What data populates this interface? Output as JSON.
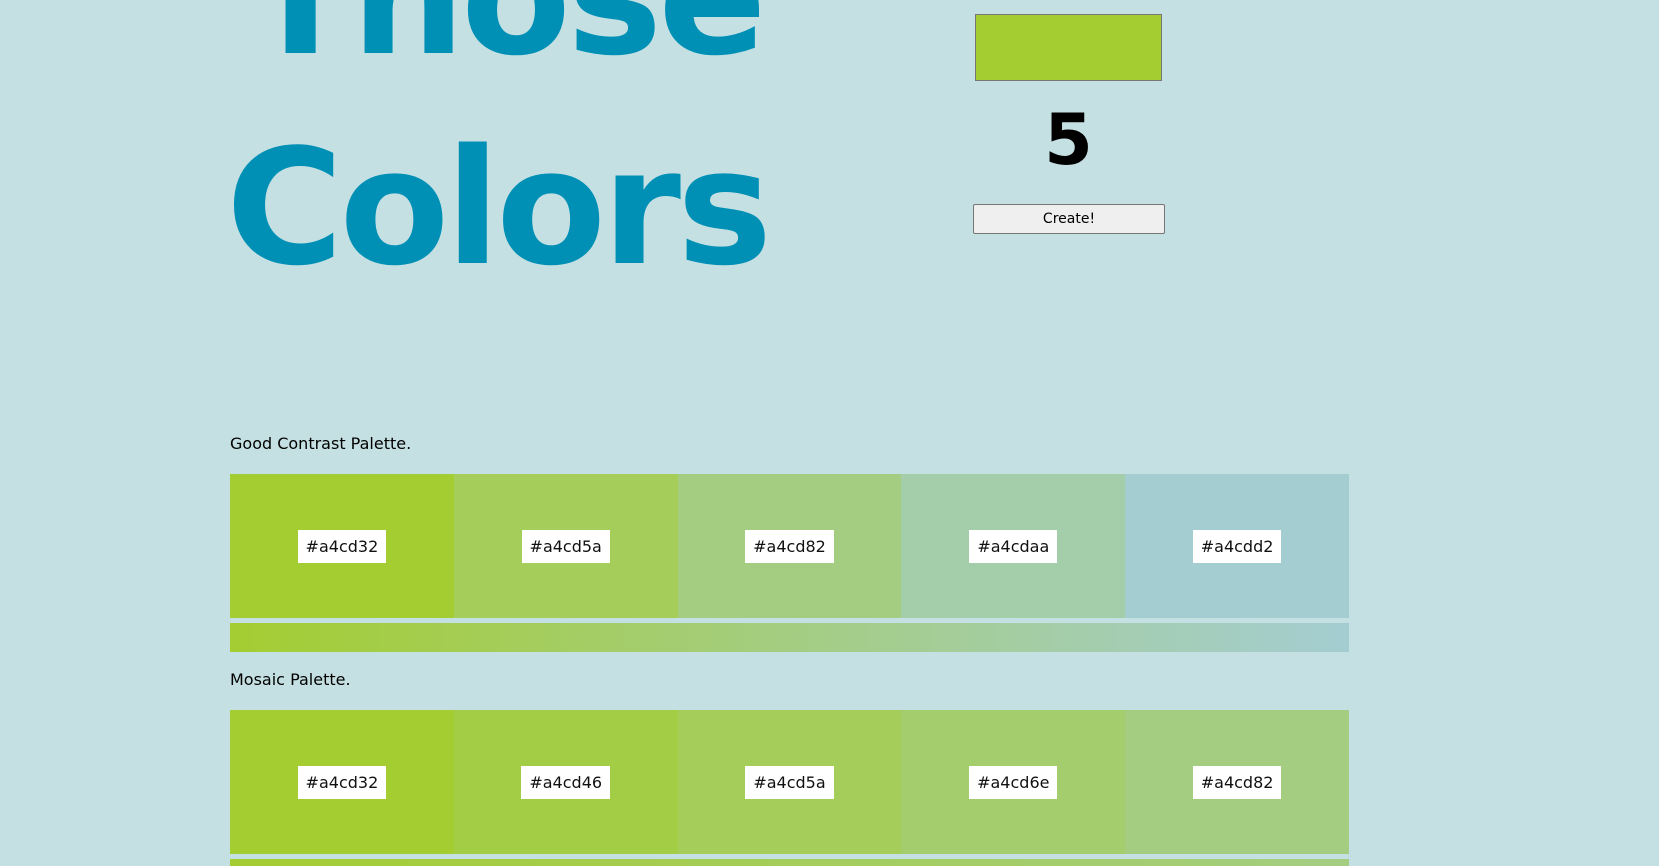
{
  "header": {
    "title_line_1": "Those",
    "title_line_2": "Colors"
  },
  "controls": {
    "selected_color": "#a4cd32",
    "count": "5",
    "create_label": "Create!"
  },
  "palettes": [
    {
      "label": "Good Contrast Palette.",
      "colors": [
        "#a4cd32",
        "#a4cd5a",
        "#a4cd82",
        "#a4cdaa",
        "#a4cdd2"
      ]
    },
    {
      "label": "Mosaic Palette.",
      "colors": [
        "#a4cd32",
        "#a4cd46",
        "#a4cd5a",
        "#a4cd6e",
        "#a4cd82"
      ]
    }
  ],
  "theme": {
    "background": "#c5e0e2",
    "title_color": "#0090b6"
  }
}
